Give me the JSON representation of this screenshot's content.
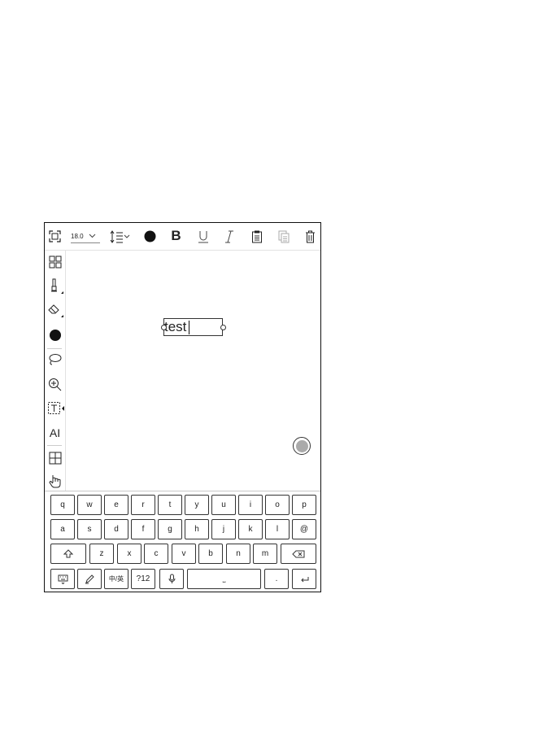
{
  "toolbar": {
    "font_size": "18.0",
    "icons": [
      "fullscreen-icon",
      "line-spacing-icon",
      "color-dot-icon",
      "bold-icon",
      "underline-icon",
      "italic-icon",
      "paste-icon",
      "copy-icon",
      "trash-icon"
    ],
    "bold_label": "B"
  },
  "sidebar": {
    "icons": [
      "layout-grid-icon",
      "pen-icon",
      "eraser-icon",
      "color-fill-icon",
      "lasso-icon",
      "zoom-in-icon",
      "textbox-icon",
      "ai-text-icon",
      "table-icon",
      "touch-hand-icon"
    ],
    "ai_label": "AI"
  },
  "canvas": {
    "text_box_value": "test"
  },
  "keyboard": {
    "row1": [
      "q",
      "w",
      "e",
      "r",
      "t",
      "y",
      "u",
      "i",
      "o",
      "p"
    ],
    "row2": [
      "a",
      "s",
      "d",
      "f",
      "g",
      "h",
      "j",
      "k",
      "l",
      "@"
    ],
    "row3": [
      "z",
      "x",
      "c",
      "v",
      "b",
      "n",
      "m"
    ],
    "lang_label": "中/英",
    "symbols_label": "?12",
    "space_label": "⎵",
    "period_label": "."
  }
}
